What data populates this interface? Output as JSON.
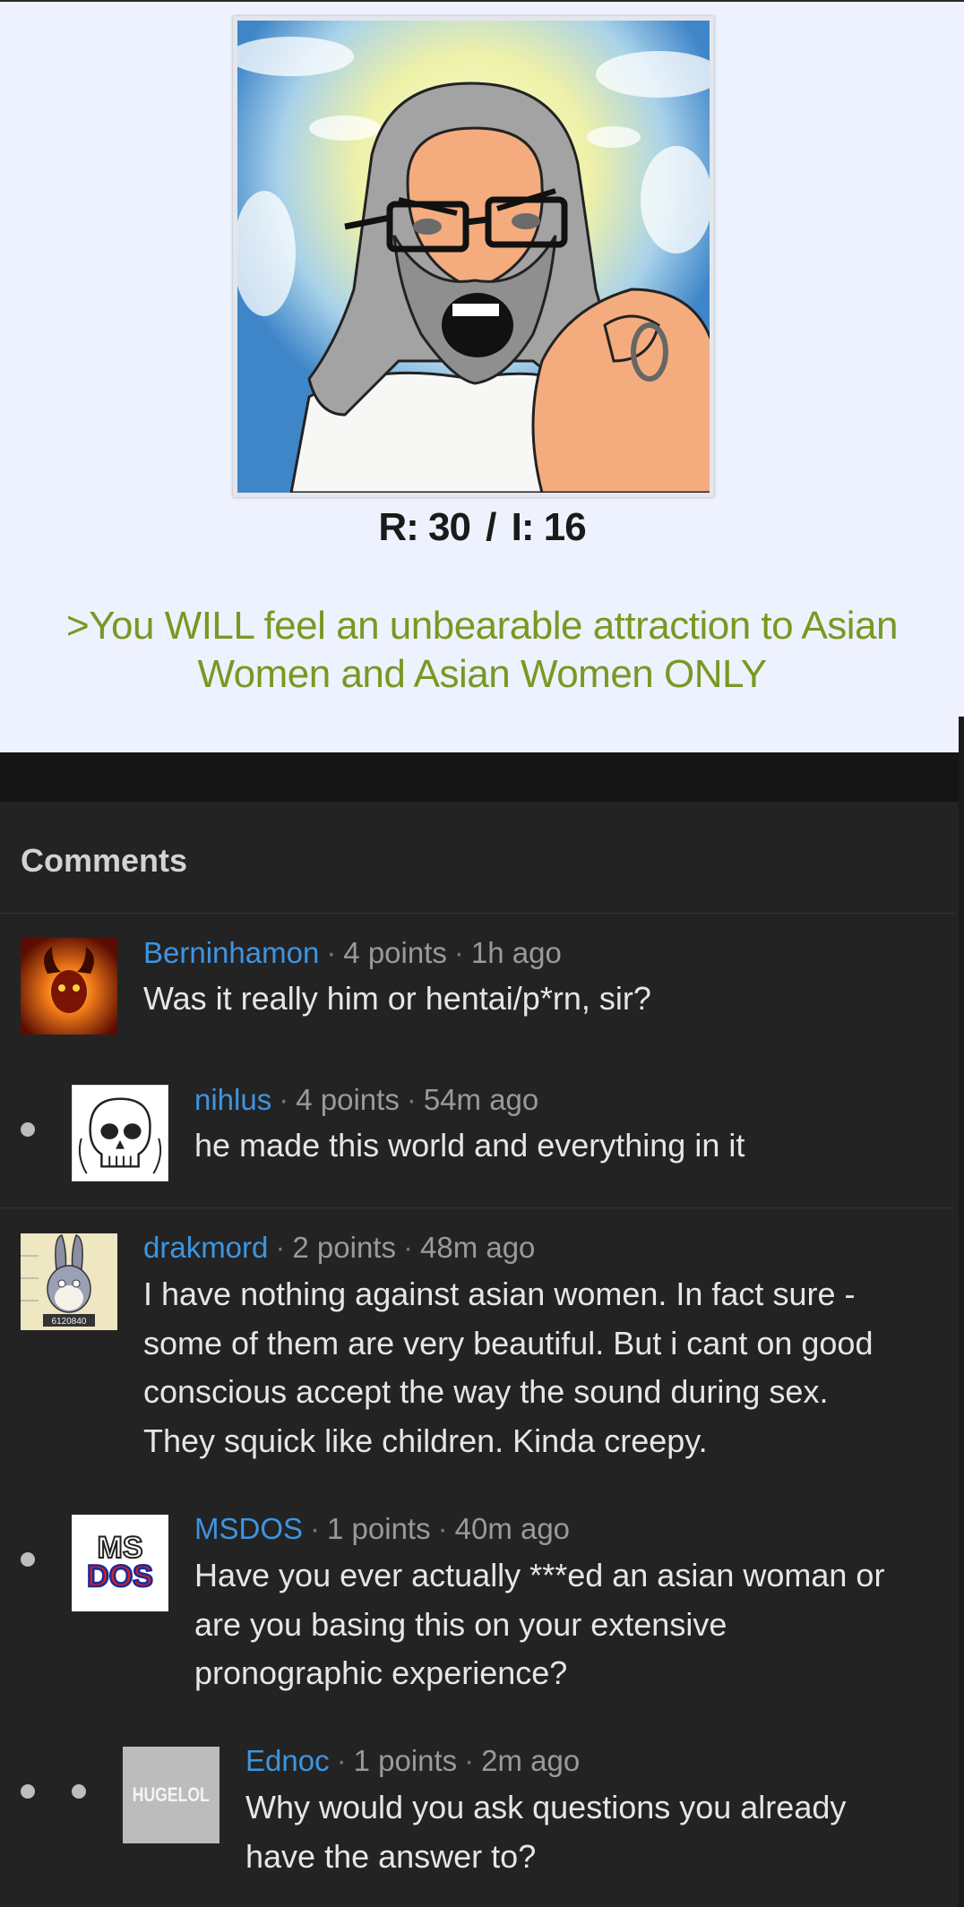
{
  "post": {
    "image_alt": "angry bearded god pointing",
    "stats_replies": "R: 30",
    "stats_separator": "/",
    "stats_images": "I: 16",
    "greentext_line1": ">You WILL feel an unbearable attraction to Asian",
    "greentext_line2": "Women and Asian Women ONLY",
    "greentext_color": "#789922"
  },
  "comments_section": {
    "header": "Comments",
    "accent_color": "#3e95df",
    "comments": [
      {
        "user": "Berninhamon",
        "points": "4 points",
        "time": "1h ago",
        "lines": [
          "Was it really him or hentai/p*rn, sir?"
        ],
        "avatar": "fire-demon-avatar",
        "depth": 0
      },
      {
        "user": "nihlus",
        "points": "4 points",
        "time": "54m ago",
        "lines": [
          "he made this world and everything in it"
        ],
        "avatar": "skull-avatar",
        "depth": 1
      },
      {
        "user": "drakmord",
        "points": "2 points",
        "time": "48m ago",
        "lines": [
          "I have nothing against asian women. In fact sure -",
          "some of them are very beautiful. But i cant on good",
          "conscious accept the way the sound during sex.",
          "They squick like children. Kinda creepy."
        ],
        "avatar": "bugs-bunny-mugshot-avatar",
        "avatar_caption": "6120840",
        "depth": 0
      },
      {
        "user": "MSDOS",
        "points": "1 points",
        "time": "40m ago",
        "lines": [
          "Have you ever actually ***ed an asian woman or",
          "are you basing this on your extensive",
          "pronographic experience?"
        ],
        "avatar": "msdos-logo-avatar",
        "avatar_text_top": "MS",
        "avatar_text_bottom": "DOS",
        "depth": 1
      },
      {
        "user": "Ednoc",
        "points": "1 points",
        "time": "2m ago",
        "lines": [
          "Why would you ask questions you already",
          "have the answer to?"
        ],
        "avatar": "hugelol-avatar",
        "avatar_text": "HUGELOL",
        "depth": 2
      }
    ]
  }
}
